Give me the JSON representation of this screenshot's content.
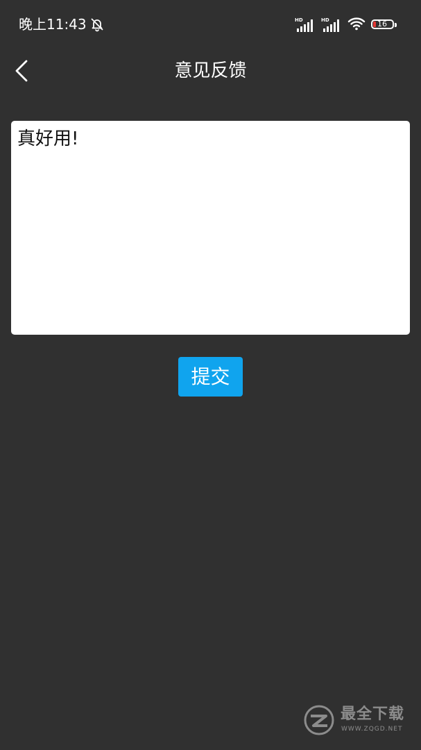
{
  "status_bar": {
    "time": "晚上11:43",
    "signal_1_label": "HD",
    "signal_2_label": "HD",
    "battery_level": "16",
    "battery_color": "#e53935",
    "icons": [
      "bell-off-icon",
      "signal-icon",
      "signal-icon",
      "wifi-icon",
      "battery-icon"
    ]
  },
  "header": {
    "title": "意见反馈",
    "back_icon": "chevron-left-icon"
  },
  "feedback": {
    "value": "真好用!"
  },
  "actions": {
    "submit_label": "提交",
    "submit_color": "#10a4ee"
  },
  "watermark": {
    "name": "最全下载",
    "url": "WWW.ZQGD.NET"
  },
  "theme": {
    "background": "#303030",
    "card": "#ffffff"
  }
}
